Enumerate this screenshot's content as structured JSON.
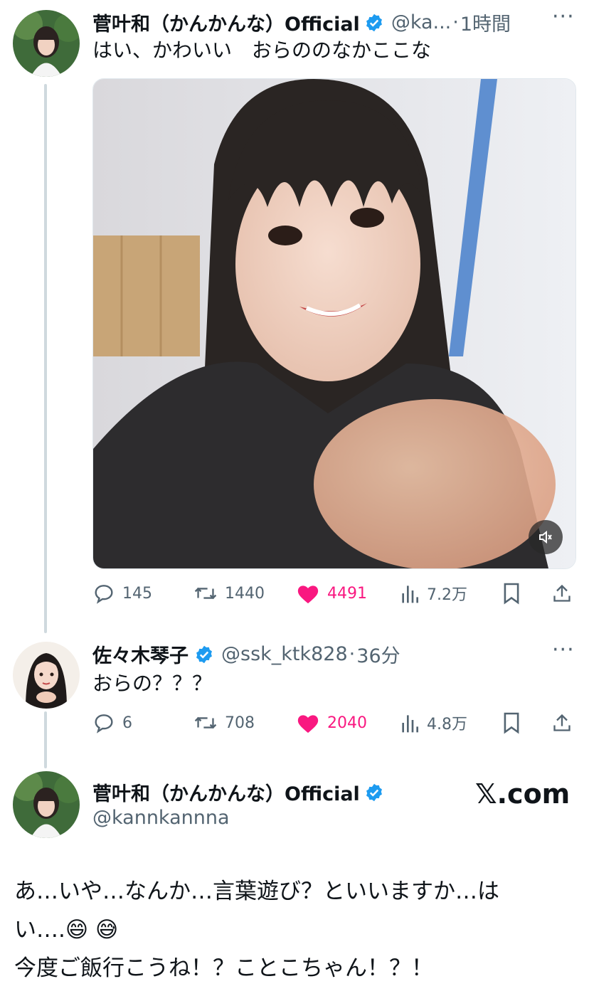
{
  "tweet1": {
    "name": "菅叶和（かんかんな）Official",
    "handle": "@ka...",
    "time": "1時間",
    "text": "はい、かわいい　おらののなかここな",
    "stats": {
      "replies": "145",
      "retweets": "1440",
      "likes": "4491",
      "views": "7.2万"
    },
    "liked": true
  },
  "tweet2": {
    "name": "佐々木琴子",
    "handle": "@ssk_ktk828",
    "time": "36分",
    "text": "おらの？？？",
    "stats": {
      "replies": "6",
      "retweets": "708",
      "likes": "2040",
      "views": "4.8万"
    },
    "liked": true
  },
  "tweet3": {
    "name": "菅叶和（かんかんな）Official",
    "handle": "@kannkannna",
    "brand": "𝕏.com",
    "text_line1": "あ…いや…なんか…言葉遊び？といいますか…は",
    "text_line2": "い….😄 😅",
    "text_line3": "今度ご飯行こうね！？ことこちゃん！？！"
  },
  "colors": {
    "verified": "#1d9bf0",
    "like": "#f91880",
    "muted": "#536471"
  },
  "icons": [
    "reply-icon",
    "retweet-icon",
    "like-icon",
    "views-icon",
    "bookmark-icon",
    "share-icon",
    "verified-badge-icon",
    "mute-icon",
    "more-icon"
  ]
}
